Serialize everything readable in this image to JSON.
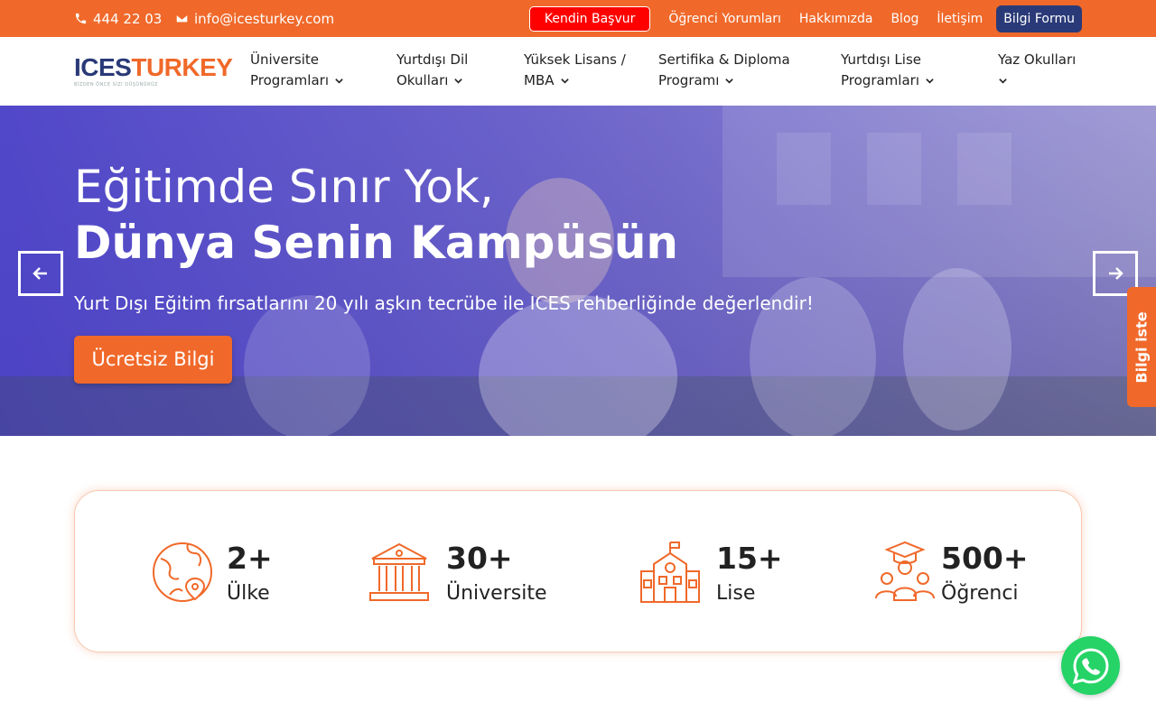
{
  "topbar": {
    "phone": "444 22 03",
    "email": "info@icesturkey.com",
    "links": [
      "Kendin Başvur",
      "Öğrenci Yorumları",
      "Hakkımızda",
      "Blog",
      "İletişim",
      "Bilgi Formu"
    ]
  },
  "logo": {
    "part1": "ICES",
    "part2": "TURKEY",
    "tagline": "BİZDEN ÖNCE SİZİ DÜŞÜNÜRÜZ"
  },
  "nav": [
    {
      "line1": "Üniversite",
      "line2": "Programları"
    },
    {
      "line1": "Yurtdışı Dil",
      "line2": "Okulları"
    },
    {
      "line1": "Yüksek Lisans /",
      "line2": "MBA"
    },
    {
      "line1": "Sertifika & Diploma",
      "line2": "Programı"
    },
    {
      "line1": "Yurtdışı Lise",
      "line2": "Programları"
    },
    {
      "line1": "Yaz Okulları",
      "line2": ""
    }
  ],
  "hero": {
    "title": "Eğitimde Sınır Yok,",
    "title_bold": "Dünya Senin Kampüsün",
    "subtitle": "Yurt Dışı Eğitim fırsatlarını 20 yılı aşkın tecrübe ile ICES rehberliğinde değerlendir!",
    "cta": "Ücretsiz Bilgi"
  },
  "side_tab": "Bilgi iste",
  "stats": [
    {
      "icon": "globe-icon",
      "value": "2+",
      "label": "Ülke"
    },
    {
      "icon": "university-icon",
      "value": "30+",
      "label": "Üniversite"
    },
    {
      "icon": "school-icon",
      "value": "15+",
      "label": "Lise"
    },
    {
      "icon": "students-icon",
      "value": "500+",
      "label": "Öğrenci"
    }
  ],
  "colors": {
    "accent": "#f0692a",
    "brand_blue": "#2a3a78",
    "apply_red": "#ff0000",
    "whatsapp": "#25d366"
  }
}
